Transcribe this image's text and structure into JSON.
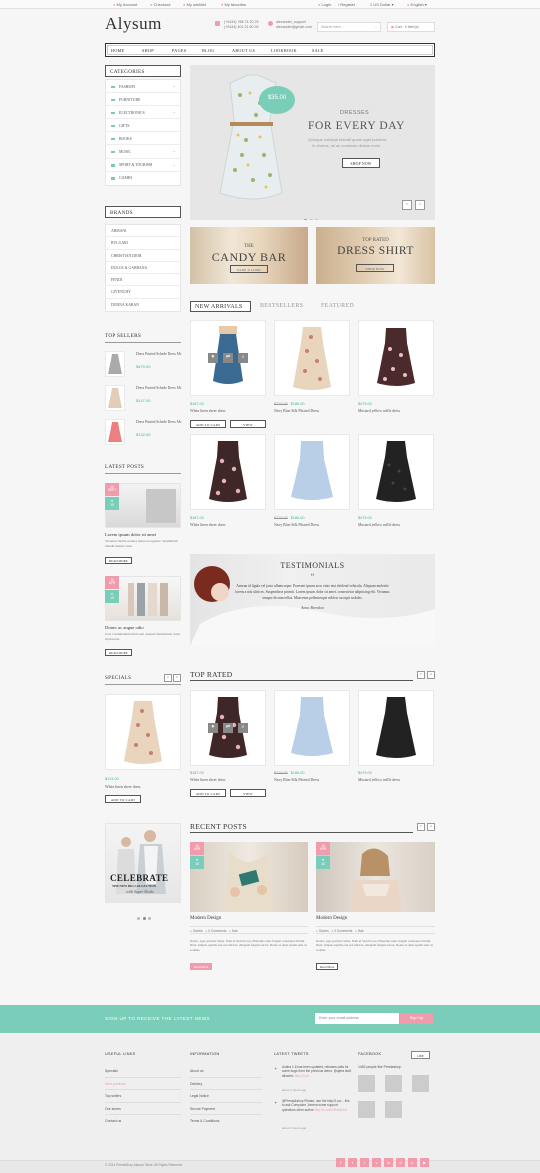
{
  "topbar": {
    "my_account": "My Account",
    "checkout": "Checkout",
    "wishlist": "My wishlist",
    "favorites": "My favorites",
    "login": "Login",
    "register": "Register",
    "currency": "US Dollar",
    "language": "English"
  },
  "header": {
    "logo": "Alysum",
    "phone1": "(+0434) 768 74 20 78",
    "phone2": "(+0434) 401 21 60 35",
    "skype": "alexander_support",
    "email": "alexander@gmail.com",
    "search_placeholder": "Search here...",
    "cart": "Cart : 0 item(s)"
  },
  "nav": [
    "HOME",
    "SHOP",
    "PAGES",
    "BLOG",
    "ABOUT US",
    "LOOKBOOK",
    "SALE"
  ],
  "categories": {
    "title": "CATEGORIES",
    "items": [
      "FASHION",
      "FURNITURE",
      "ELECTRONICS",
      "GIFTS",
      "BOOKS",
      "MUSIC",
      "SPORT & TOURISM",
      "GAMES"
    ]
  },
  "brands": {
    "title": "BRANDS",
    "items": [
      "ARMANI",
      "BVLGARI",
      "CHRISTIAN DIOR",
      "DOLCE & GABBANA",
      "FENDI",
      "GIVENCHY",
      "DONNA KARAN"
    ]
  },
  "slider": {
    "price": "$35.00",
    "kicker": "DRESSES",
    "heading": "FOR EVERY DAY",
    "text1": "Quisque volutpat blandit quam eget pulvinar.",
    "text2": "In viverra, mi ac consectu dictum enim.",
    "button": "SHOP NOW"
  },
  "banners": [
    {
      "small": "THE",
      "title": "CANDY BAR",
      "button": "TAKE A LOOK"
    },
    {
      "small": "TOP RATED",
      "title": "DRESS SHIRT",
      "button": "SHOP NOW"
    }
  ],
  "tabs": [
    "NEW ARRIVALS",
    "BESTSELLERS",
    "FEATURED"
  ],
  "products": [
    {
      "old": "",
      "price": "$187.00",
      "name": "White linen sheer dress"
    },
    {
      "old": "$215.00",
      "price": "$186.00",
      "name": "Navy Blue Silk Pleated Dress"
    },
    {
      "old": "",
      "price": "$479.00",
      "name": "Mustard yellow ruffle dress"
    },
    {
      "old": "",
      "price": "$187.00",
      "name": "White linen sheer dress"
    },
    {
      "old": "$215.00",
      "price": "$186.00",
      "name": "Navy Blue Silk Pleated Dress"
    },
    {
      "old": "",
      "price": "$479.00",
      "name": "Mustard yellow ruffle dress"
    }
  ],
  "buttons": {
    "add_to_cart": "ADD TO CART",
    "view": "VIEW",
    "read_more": "READ MORE",
    "read_more_cap": "Read More"
  },
  "top_sellers": {
    "title": "TOP SELLERS",
    "items": [
      {
        "name": "Dress Printed Schede Dress Mc",
        "price": "$470.00"
      },
      {
        "name": "Dress Printed Schede Dress Mc",
        "price": "$147.00"
      },
      {
        "name": "Dress Printed Schede Dress Mc",
        "price": "$132.00"
      }
    ]
  },
  "latest_posts": {
    "title": "LATEST POSTS",
    "items": [
      {
        "day": "10",
        "month": "SEPT",
        "likes": "10",
        "title": "Lorem ipsum dolor sit amet",
        "text": "Vivamus mollis sodales massa in egestas. Vestibulum blandit mauris vitae."
      },
      {
        "day": "10",
        "month": "APR",
        "likes": "15",
        "title": "Donec ac augue odio",
        "text": "Cras condimentum nibh sem. Aenean fermentum, dolor in placerat."
      }
    ]
  },
  "testimonials": {
    "title": "TESTIMONIALS",
    "quote_mark": "“",
    "line1": "Aenean id ligula vel justo ullamcorper. Praesent ipsum arcu vitae nisi eleifend vehicula. Aliquam molestie",
    "line2": "lorem a nisi ultrices. Suspendisse potenti. Lorem ipsum dolor sit amet, consectetur adipiscing elit. Vivamus",
    "line3": "tempor dictum tellus. Maecenas pellentesque nibh ut suscipit sodales.",
    "author": "Anna Brendon"
  },
  "specials": {
    "title": "SPECIALS",
    "price": "$124.00",
    "name": "White linen sheer dress",
    "button": "ADD TO CART"
  },
  "top_rated": {
    "title": "TOP RATED"
  },
  "celebrate": {
    "title": "CELEBRATE",
    "sub": "THE NEW BIG COLLECTION",
    "script": "with Super Deals"
  },
  "recent_posts": {
    "title": "RECENT POSTS",
    "items": [
      {
        "day": "10",
        "month": "APR",
        "likes": "15",
        "title": "Modern Design",
        "author": "Stories",
        "comments": "0 Comments",
        "tag": "Hair",
        "text": "Donec, eget porttitor tellus. Nam ut Search eros. Phasellus nunc feugiat consequat dictum. Nunc tempus sagittis erat sed ultrices. Aliquam feugiat auctor. Donec et amet ipsum sem, in sodales."
      },
      {
        "day": "10",
        "month": "APR",
        "likes": "15",
        "title": "Modern Design",
        "author": "Stories",
        "comments": "0 Comments",
        "tag": "Hair",
        "text": "Donec, eget porttitor tellus. Nam ut Search eros. Phasellus nunc feugiat consequat dictum. Nunc tempus sagittis erat sed ultrices. Aliquam feugiat auctor. Donec et amet ipsum sem, in sodales."
      }
    ]
  },
  "newsletter": {
    "label": "SIGN UP TO RECEIVE THE LATEST NEWS",
    "placeholder": "Enter your email address",
    "button": "Sign Up"
  },
  "footer": {
    "useful_title": "USEFUL LINKS",
    "useful": [
      "Specials",
      "New products",
      "Top sellers",
      "Our stores",
      "Contact us"
    ],
    "info_title": "INFORMATION",
    "info": [
      "About us",
      "Delivery",
      "Legal Notice",
      "Secure Payment",
      "Terms & Conditions"
    ],
    "tweets_title": "LATEST TWEETS",
    "tweet1": "Avatra 1.6 has been updated, releases calls for some bugs from the previous demo. @ajera stuff, allowed.",
    "tweet1_link": "http://t.co/...",
    "tweet1_time": "about 1 hours ago",
    "tweet2": "@Presta&shop Please, use the http://t.co/... link to ask Composer Jomera some support questions other author",
    "tweet2_link": "http://t.co/4bnRwWnhd",
    "tweet2_time": "about 1 hours ago",
    "facebook_title": "FACEBOOK",
    "like": "Like",
    "fb_text": "1452 people like Prestashop",
    "copyright": "© 2014 PrestaShop Alysum Store. All Rights Reserved."
  },
  "social_icons": [
    "facebook-icon",
    "twitter-icon",
    "rss-icon",
    "vimeo-icon",
    "linkedin-icon",
    "dribbble-icon",
    "pinterest-icon",
    "youtube-icon"
  ],
  "colors": {
    "accent": "#79cdb9",
    "pink": "#f19cad",
    "price": "#45b59c"
  }
}
